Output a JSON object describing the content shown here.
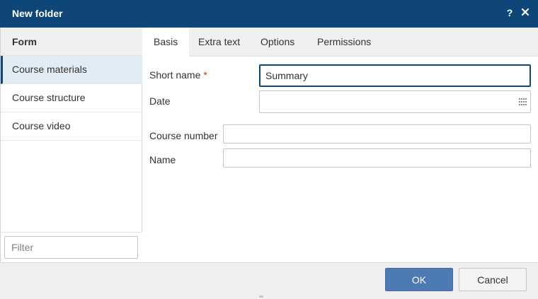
{
  "dialog": {
    "title": "New folder",
    "help_glyph": "?",
    "close_icon": "close-icon"
  },
  "sidebar": {
    "header": "Form",
    "items": [
      {
        "label": "Course materials",
        "active": true
      },
      {
        "label": "Course structure",
        "active": false
      },
      {
        "label": "Course video",
        "active": false
      }
    ],
    "filter_placeholder": "Filter"
  },
  "tabs": [
    {
      "label": "Basis",
      "active": true
    },
    {
      "label": "Extra text",
      "active": false
    },
    {
      "label": "Options",
      "active": false
    },
    {
      "label": "Permissions",
      "active": false
    }
  ],
  "form": {
    "short_name": {
      "label": "Short name",
      "required_mark": "*",
      "value": "Summary"
    },
    "date": {
      "label": "Date",
      "value": "",
      "icon": "calendar-grid-icon"
    },
    "course_number": {
      "label": "Course number",
      "value": ""
    },
    "name": {
      "label": "Name",
      "value": ""
    }
  },
  "footer": {
    "ok_label": "OK",
    "cancel_label": "Cancel"
  },
  "colors": {
    "titlebar": "#0e4777",
    "ok_button": "#4d79b5",
    "active_item_bg": "#e2ecf4",
    "required": "#c0392b"
  }
}
